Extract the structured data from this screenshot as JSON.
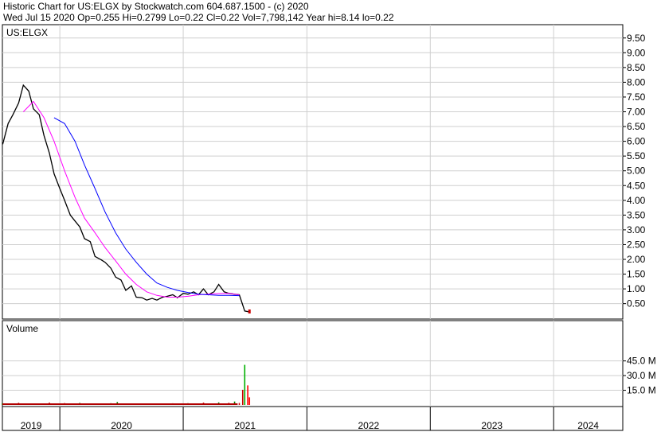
{
  "header": {
    "line1": "Historic Chart for US:ELGX by Stockwatch.com 604.687.1500 - (c) 2020",
    "line2": "Wed Jul 15 2020  Op=0.255  Hi=0.2799  Lo=0.22  Cl=0.22  Vol=7,798,142  Year hi=8.14  lo=0.22"
  },
  "chart_data": [
    {
      "type": "line",
      "panel": "price",
      "title": "US:ELGX",
      "ylim": [
        0,
        10
      ],
      "yticks": [
        "9.50",
        "9.00",
        "8.50",
        "8.00",
        "7.50",
        "7.00",
        "6.50",
        "6.00",
        "5.50",
        "5.00",
        "4.50",
        "4.00",
        "3.50",
        "3.00",
        "2.50",
        "2.00",
        "1.50",
        "1.00",
        "0.50"
      ],
      "grid": true,
      "series": [
        {
          "color": "#000000",
          "x": [
            "2018-07-16",
            "2018-08-01",
            "2018-08-15",
            "2018-09-01",
            "2018-09-15",
            "2018-10-01",
            "2018-10-15",
            "2018-11-01",
            "2018-11-15",
            "2018-12-01",
            "2018-12-15",
            "2019-01-01",
            "2019-01-15",
            "2019-02-01",
            "2019-02-15",
            "2019-03-01",
            "2019-03-15",
            "2019-04-01",
            "2019-04-15",
            "2019-05-01",
            "2019-05-15",
            "2019-06-01",
            "2019-06-15",
            "2019-07-01",
            "2019-07-15",
            "2019-08-01",
            "2019-08-15",
            "2019-09-01",
            "2019-09-15",
            "2019-10-01",
            "2019-10-15",
            "2019-11-01",
            "2019-11-15",
            "2019-12-01",
            "2019-12-15",
            "2020-01-01",
            "2020-01-15",
            "2020-02-01",
            "2020-02-15",
            "2020-03-01",
            "2020-03-15",
            "2020-04-01",
            "2020-04-15",
            "2020-05-01",
            "2020-05-15",
            "2020-06-01",
            "2020-06-15",
            "2020-07-01",
            "2020-07-15"
          ],
          "y": [
            5.9,
            6.6,
            6.9,
            7.3,
            7.9,
            7.7,
            7.1,
            6.9,
            6.2,
            5.6,
            4.9,
            4.4,
            4.0,
            3.5,
            3.3,
            3.1,
            2.7,
            2.6,
            2.1,
            2.0,
            1.9,
            1.7,
            1.4,
            1.3,
            0.95,
            1.1,
            0.72,
            0.7,
            0.62,
            0.68,
            0.62,
            0.72,
            0.75,
            0.8,
            0.7,
            0.85,
            0.82,
            0.9,
            0.8,
            1.0,
            0.8,
            0.9,
            1.15,
            0.9,
            0.85,
            0.82,
            0.8,
            0.25,
            0.22
          ]
        },
        {
          "color": "#ff00ff",
          "x": [
            "2018-09-15",
            "2018-10-15",
            "2018-11-15",
            "2018-12-15",
            "2019-01-15",
            "2019-02-15",
            "2019-03-15",
            "2019-04-15",
            "2019-05-15",
            "2019-06-15",
            "2019-07-15",
            "2019-08-15",
            "2019-09-15",
            "2019-10-15",
            "2019-11-15",
            "2019-12-15",
            "2020-01-15",
            "2020-02-15",
            "2020-03-15",
            "2020-04-15",
            "2020-05-15",
            "2020-06-15"
          ],
          "y": [
            7.0,
            7.35,
            6.8,
            6.0,
            5.0,
            4.1,
            3.4,
            2.9,
            2.4,
            1.95,
            1.5,
            1.15,
            0.9,
            0.78,
            0.72,
            0.72,
            0.75,
            0.8,
            0.82,
            0.84,
            0.85,
            0.8
          ]
        },
        {
          "color": "#0000ff",
          "x": [
            "2018-12-15",
            "2019-01-15",
            "2019-02-15",
            "2019-03-15",
            "2019-04-15",
            "2019-05-15",
            "2019-06-15",
            "2019-07-15",
            "2019-08-15",
            "2019-09-15",
            "2019-10-15",
            "2019-11-15",
            "2019-12-15",
            "2020-01-15",
            "2020-02-15",
            "2020-03-15",
            "2020-04-15",
            "2020-05-15",
            "2020-06-15"
          ],
          "y": [
            6.8,
            6.6,
            6.0,
            5.2,
            4.4,
            3.6,
            2.9,
            2.35,
            1.9,
            1.5,
            1.2,
            1.05,
            0.95,
            0.88,
            0.82,
            0.8,
            0.78,
            0.78,
            0.77
          ]
        }
      ]
    },
    {
      "type": "bar",
      "panel": "volume",
      "title": "Volume",
      "ylim": [
        0,
        55
      ],
      "yticks": [
        "45.0 M",
        "30.0 M",
        "15.0 M"
      ],
      "grid": true,
      "x": [
        "2018-07-15",
        "2018-09-01",
        "2018-10-15",
        "2018-12-01",
        "2019-01-15",
        "2019-03-01",
        "2019-04-15",
        "2019-06-01",
        "2019-06-20",
        "2019-07-15",
        "2019-09-01",
        "2019-10-15",
        "2019-12-01",
        "2020-01-15",
        "2020-03-01",
        "2020-04-15",
        "2020-05-15",
        "2020-06-01",
        "2020-06-15",
        "2020-06-25",
        "2020-07-01",
        "2020-07-10",
        "2020-07-15"
      ],
      "values": [
        1.8,
        2.2,
        1.6,
        2.4,
        1.9,
        2.1,
        1.5,
        1.8,
        3.0,
        1.6,
        1.4,
        1.5,
        1.7,
        1.8,
        2.4,
        2.6,
        2.2,
        3.5,
        2.0,
        15.5,
        41.0,
        20.0,
        7.8
      ],
      "colors": [
        "#008000",
        "#cc0000",
        "#008000",
        "#cc0000",
        "#cc0000",
        "#008000",
        "#cc0000",
        "#008000",
        "#008000",
        "#cc0000",
        "#cc0000",
        "#008000",
        "#cc0000",
        "#008000",
        "#cc0000",
        "#008000",
        "#cc0000",
        "#008000",
        "#cc0000",
        "#cc0000",
        "#00b000",
        "#ff0000",
        "#ff0000"
      ]
    }
  ],
  "x_axis": {
    "labels": [
      "2019",
      "2020",
      "2021",
      "2022",
      "2023",
      "2024"
    ]
  }
}
